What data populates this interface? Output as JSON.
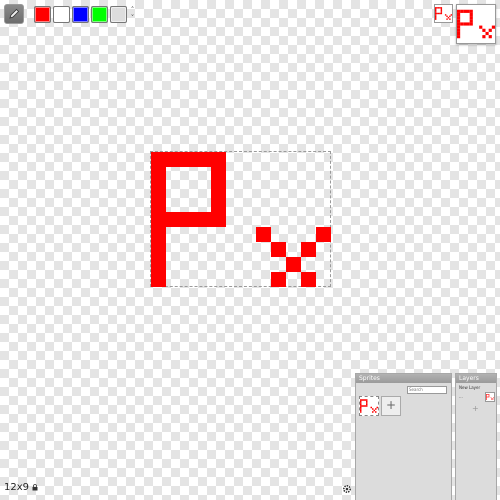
{
  "toolbar": {
    "palette": [
      "#ff0000",
      "#ffffff",
      "#0000ff",
      "#00ff00",
      "#dddddd"
    ],
    "pencil_icon": "pencil-icon",
    "stepper_up": "˄",
    "stepper_down": "˅"
  },
  "canvas": {
    "fill_color": "#ff0000",
    "pixel_rows": [
      "111110000000",
      "100010000000",
      "100010000000",
      "100010000000",
      "111110000000",
      "100000010001",
      "100000001010",
      "100000000100",
      "100000001010"
    ]
  },
  "status": {
    "size": "12x9"
  },
  "panels": {
    "sprites": {
      "title": "Sprites",
      "search_placeholder": "Search",
      "add_label": "+"
    },
    "layers": {
      "title": "Layers",
      "new_layer_label": "New Layer",
      "layer_icon": "···",
      "add_label": "+"
    }
  }
}
